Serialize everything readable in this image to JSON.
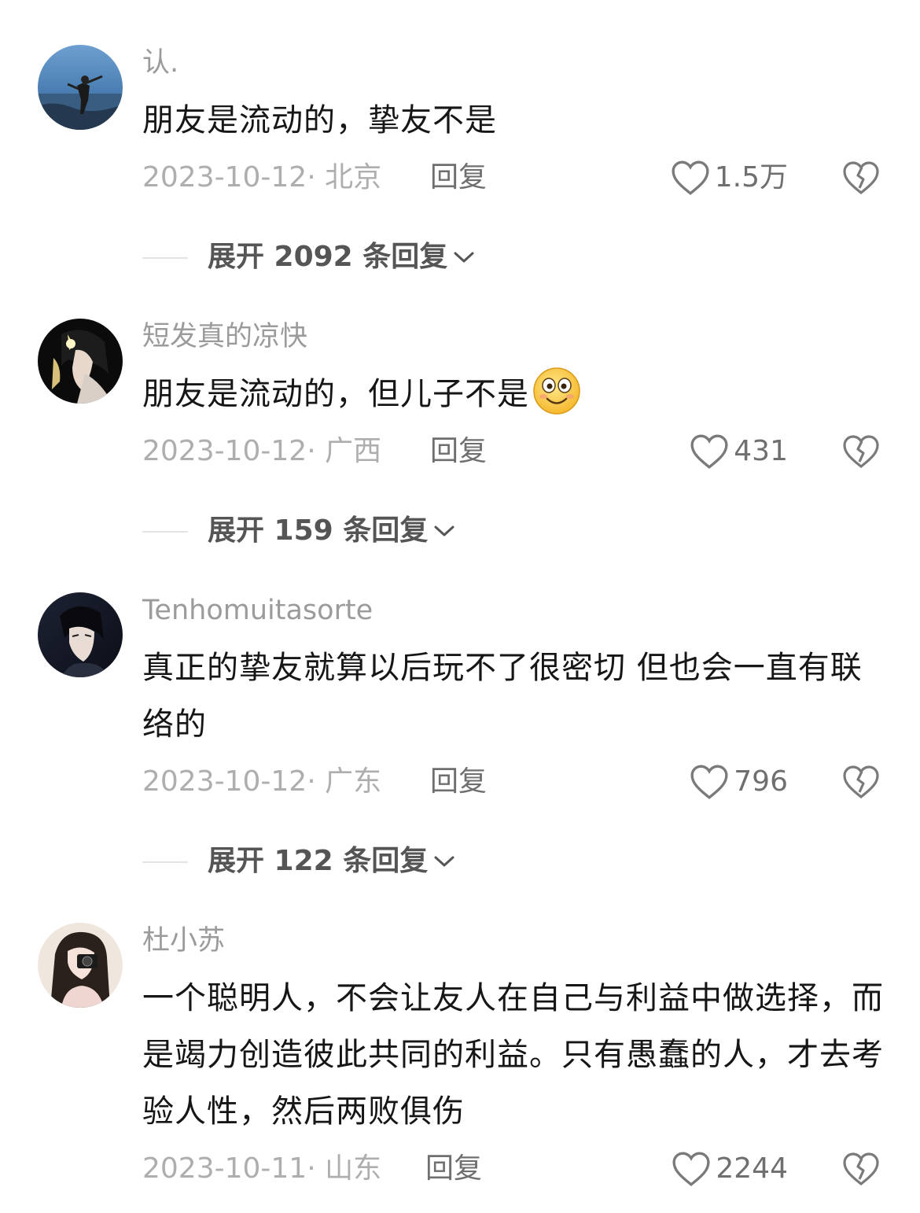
{
  "comments": [
    {
      "username": "认.",
      "text": "朋友是流动的，挚友不是",
      "date_location": "2023-10-12· 北京",
      "reply_label": "回复",
      "likes": "1.5万",
      "expand_label": "展开 2092 条回复"
    },
    {
      "username": "短发真的凉快",
      "text": "朋友是流动的，但儿子不是",
      "emoji": "smile-emoji",
      "date_location": "2023-10-12· 广西",
      "reply_label": "回复",
      "likes": "431",
      "expand_label": "展开 159 条回复"
    },
    {
      "username": "Tenhomuitasorte",
      "text": "真正的挚友就算以后玩不了很密切 但也会一直有联络的",
      "date_location": "2023-10-12· 广东",
      "reply_label": "回复",
      "likes": "796",
      "expand_label": "展开 122 条回复"
    },
    {
      "username": "杜小苏",
      "text": "一个聪明人，不会让友人在自己与利益中做选择，而是竭力创造彼此共同的利益。只有愚蠢的人，才去考验人性，然后两败俱伤",
      "date_location": "2023-10-11· 山东",
      "reply_label": "回复",
      "likes": "2244"
    }
  ],
  "colors": {
    "username": "#9b9b9b",
    "text": "#161616",
    "meta": "#aeaeae",
    "action": "#6f6f6f"
  },
  "icons": [
    "heart-outline-icon",
    "broken-heart-icon",
    "chevron-down-icon"
  ]
}
